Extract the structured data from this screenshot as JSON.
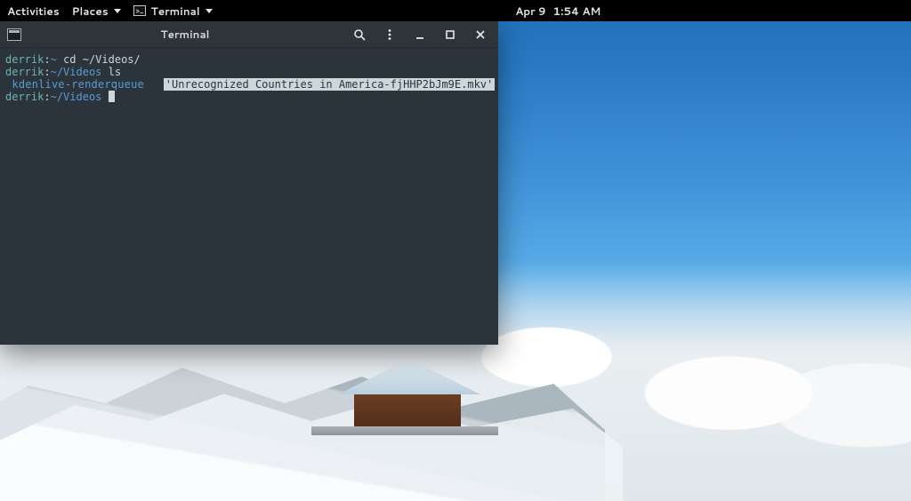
{
  "topbar": {
    "activities": "Activities",
    "places": "Places",
    "app_label": "Terminal",
    "date": "Apr 9",
    "time": "1:54 AM"
  },
  "window": {
    "title": "Terminal"
  },
  "terminal": {
    "user": "derrik",
    "host_sep": ":",
    "home_path": "~",
    "videos_path": "~/Videos",
    "cmd_cd": "cd ~/Videos/",
    "cmd_ls": "ls",
    "listing_dir": " kdenlive-renderqueue ",
    "listing_file": "'Unrecognized Countries in America-fjHHP2bJm9E.mkv'"
  },
  "icons": {
    "term_prompt": ">_",
    "app_glyph": "▣"
  }
}
